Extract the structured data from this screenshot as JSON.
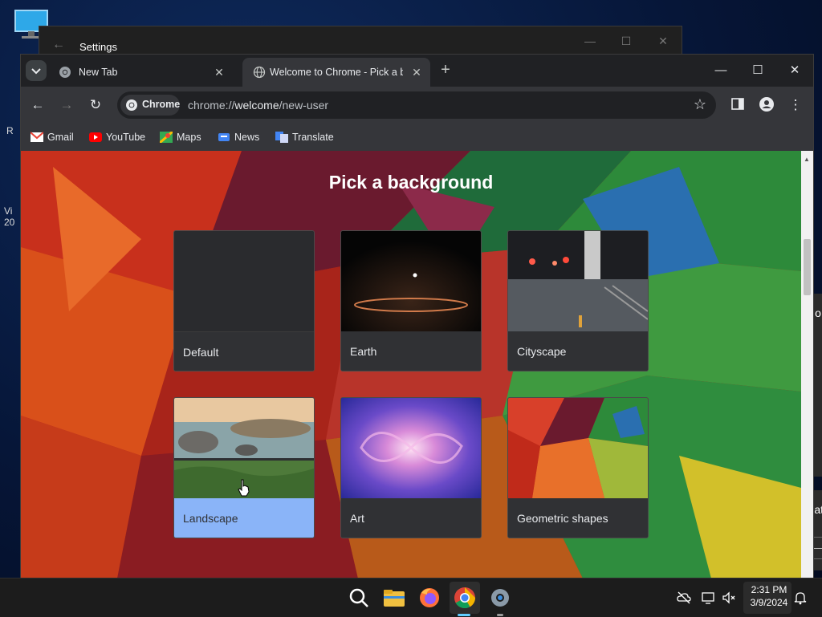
{
  "desktop": {
    "side_texts": [
      "R",
      "Vi",
      "20"
    ]
  },
  "settings_window": {
    "title": "Settings",
    "back": "←",
    "minimize": "—",
    "maximize": "☐",
    "close": "✕"
  },
  "notifications": {
    "panel1_text": "No",
    "panel2_text": "Sat",
    "panel2_button": "—"
  },
  "chrome": {
    "tabs": [
      {
        "label": "New Tab",
        "close": "✕"
      },
      {
        "label": "Welcome to Chrome - Pick a ba",
        "close": "✕"
      }
    ],
    "new_tab": "+",
    "window_controls": {
      "minimize": "—",
      "maximize": "☐",
      "close": "✕"
    },
    "toolbar": {
      "back": "←",
      "forward": "→",
      "reload": "↻",
      "chip_label": "Chrome",
      "url_prefix": "chrome://",
      "url_host": "welcome",
      "url_path": "/new-user",
      "star": "☆",
      "menu": "⋮"
    },
    "bookmarks": [
      {
        "label": "Gmail",
        "icon": "gmail-icon"
      },
      {
        "label": "YouTube",
        "icon": "youtube-icon"
      },
      {
        "label": "Maps",
        "icon": "maps-icon"
      },
      {
        "label": "News",
        "icon": "news-icon"
      },
      {
        "label": "Translate",
        "icon": "translate-icon"
      }
    ]
  },
  "page": {
    "title": "Pick a background",
    "cards": [
      {
        "label": "Default"
      },
      {
        "label": "Earth"
      },
      {
        "label": "Cityscape"
      },
      {
        "label": "Landscape",
        "selected": true
      },
      {
        "label": "Art"
      },
      {
        "label": "Geometric shapes"
      }
    ]
  },
  "taskbar": {
    "apps": [
      "search-icon",
      "file-explorer-icon",
      "firefox-icon",
      "chrome-icon",
      "settings-icon"
    ],
    "clock_time": "2:31 PM",
    "clock_date": "3/9/2024"
  },
  "colors": {
    "chrome_dark": "#202124",
    "toolbar": "#35363a",
    "selected_caption": "#8ab4f8",
    "taskbar": "#1c1c1c"
  }
}
